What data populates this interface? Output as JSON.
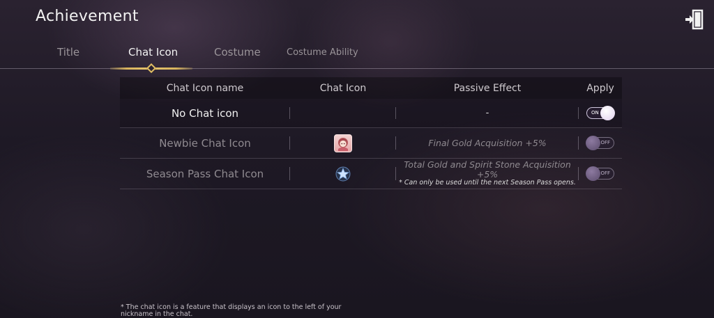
{
  "page": {
    "title": "Achievement"
  },
  "tabs": [
    {
      "label": "Title"
    },
    {
      "label": "Chat Icon"
    },
    {
      "label": "Costume"
    },
    {
      "label": "Costume Ability"
    }
  ],
  "table": {
    "headers": [
      "Chat Icon name",
      "Chat Icon",
      "Passive Effect",
      "Apply"
    ],
    "rows": [
      {
        "name": "No Chat icon",
        "icon": "",
        "effect": "-",
        "effect_note": "",
        "toggle": "ON"
      },
      {
        "name": "Newbie Chat Icon",
        "icon": "newbie-girl-icon",
        "effect": "Final Gold Acquisition +5%",
        "effect_note": "",
        "toggle": "OFF"
      },
      {
        "name": "Season Pass Chat Icon",
        "icon": "season-pass-star-icon",
        "effect": "Total Gold and Spirit Stone Acquisition +5%",
        "effect_note": "* Can only be used until the next Season Pass opens.",
        "toggle": "OFF"
      }
    ]
  },
  "footnote": "* The chat icon is a feature that displays an icon to the left of your nickname in the chat.",
  "colors": {
    "accent_gold": "#d7b35d",
    "background": "#1e1925"
  }
}
